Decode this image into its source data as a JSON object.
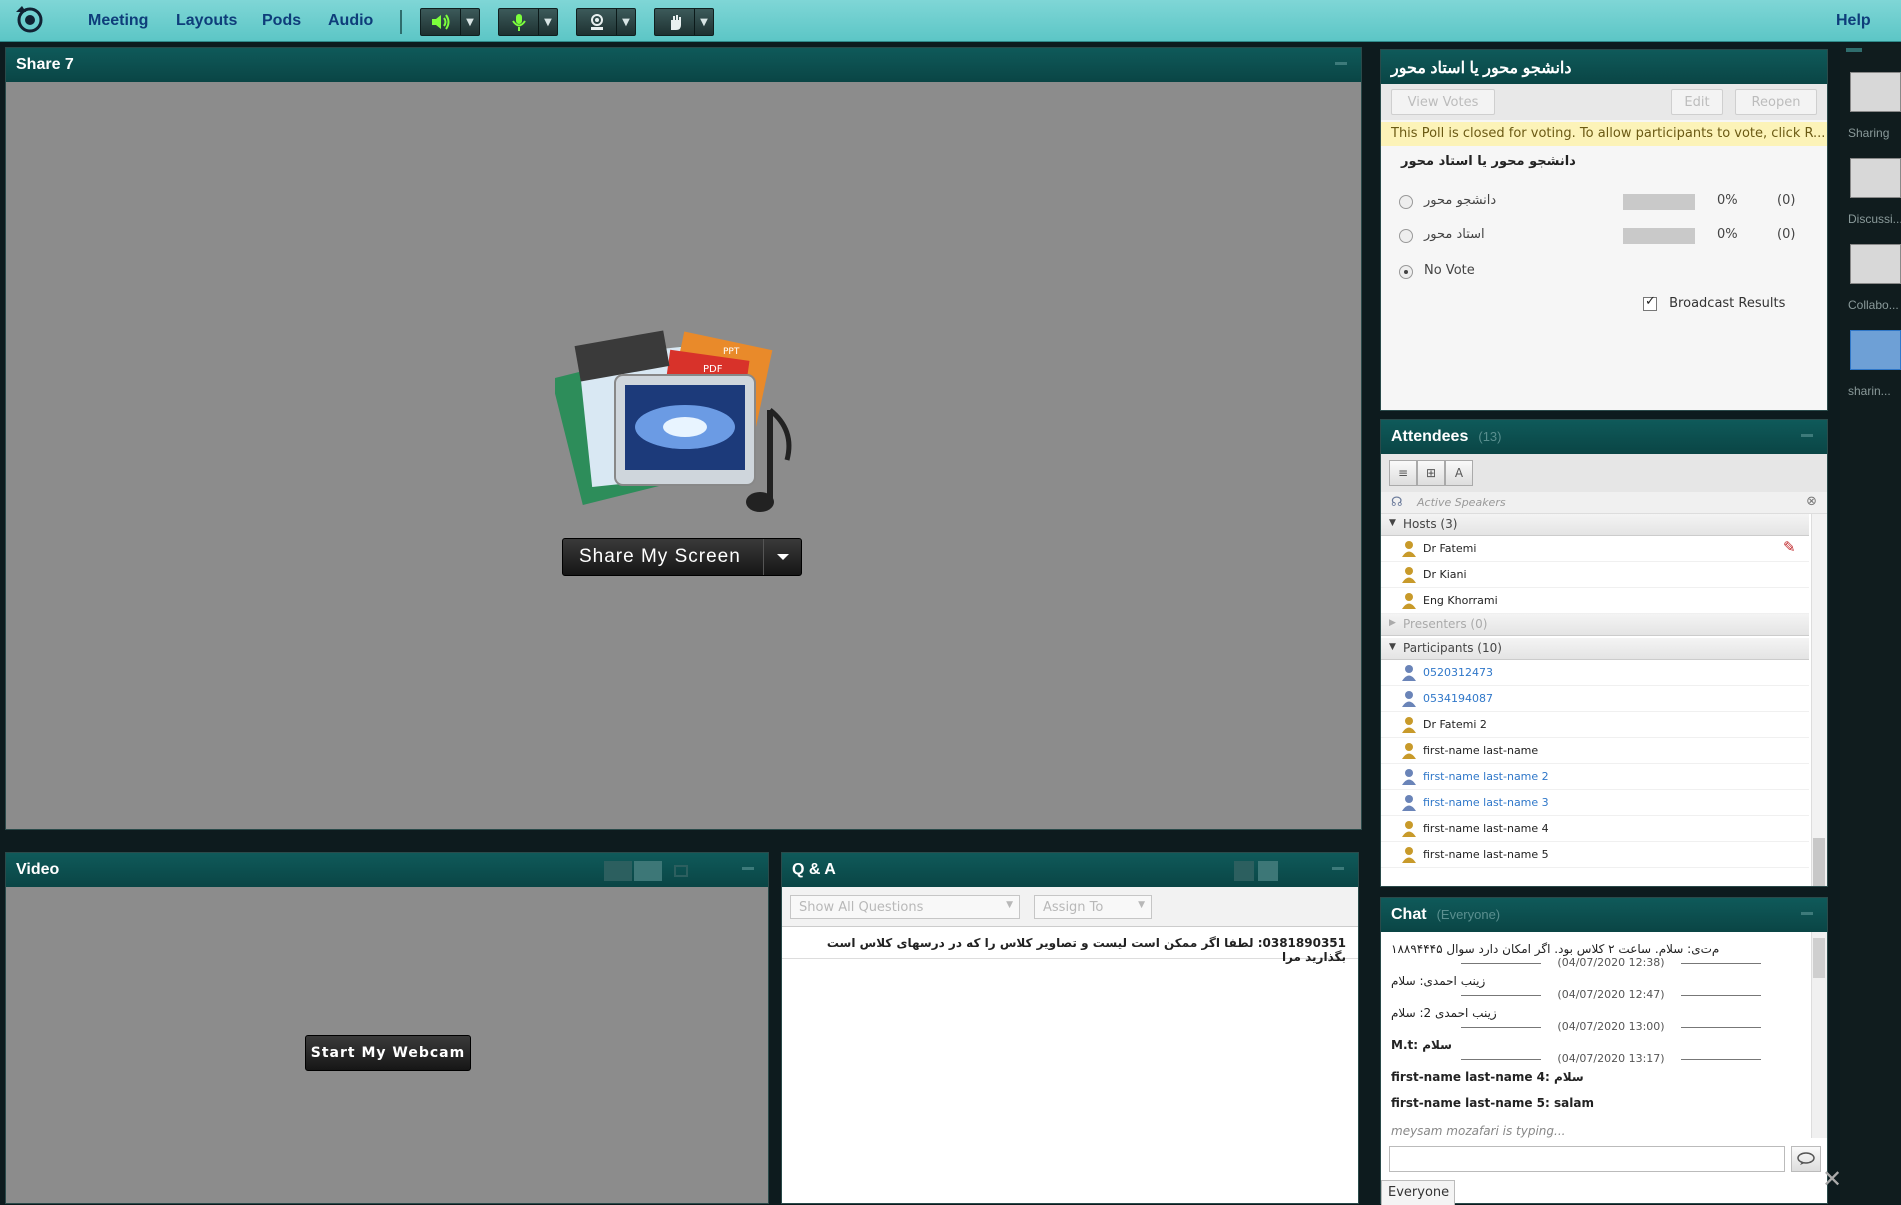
{
  "menubar": {
    "items": [
      "Meeting",
      "Layouts",
      "Pods",
      "Audio"
    ],
    "help": "Help"
  },
  "share_pod": {
    "title": "Share 7",
    "button_label": "Share My Screen"
  },
  "video_pod": {
    "title": "Video",
    "button_label": "Start My Webcam"
  },
  "qa_pod": {
    "title": "Q & A",
    "filter_placeholder": "Show All Questions",
    "assign_placeholder": "Assign To",
    "question": "0381890351: لطفا اگر ممکن است لیست و تصاویر کلاس را که در درسهای کلاس است بگذارید مرا"
  },
  "poll_pod": {
    "title": "دانشجو محور یا استاد محور",
    "view_votes": "View Votes",
    "edit": "Edit",
    "reopen": "Reopen",
    "notice": "This Poll is closed for voting. To allow participants to vote, click R...",
    "question": "دانشجو محور یا استاد محور",
    "options": [
      {
        "label": "دانشجو محور",
        "percent": "0%",
        "count": "(0)",
        "value": 0
      },
      {
        "label": "استاد محور",
        "percent": "0%",
        "count": "(0)",
        "value": 0
      }
    ],
    "no_vote": "No Vote",
    "broadcast": "Broadcast Results"
  },
  "attendees_pod": {
    "title": "Attendees",
    "count": "(13)",
    "active_speakers": "Active Speakers",
    "hosts_label": "Hosts (3)",
    "hosts": [
      "Dr Fatemi",
      "Dr Kiani",
      "Eng Khorrami"
    ],
    "presenters_label": "Presenters (0)",
    "participants_label": "Participants (10)",
    "participants": [
      {
        "name": "0520312473",
        "blue": true
      },
      {
        "name": "0534194087",
        "blue": true
      },
      {
        "name": "Dr Fatemi 2",
        "blue": false
      },
      {
        "name": "first-name last-name",
        "blue": false
      },
      {
        "name": "first-name last-name 2",
        "blue": true
      },
      {
        "name": "first-name last-name 3",
        "blue": true
      },
      {
        "name": "first-name last-name 4",
        "blue": false
      },
      {
        "name": "first-name last-name 5",
        "blue": false
      }
    ]
  },
  "chat_pod": {
    "title": "Chat",
    "scope": "(Everyone)",
    "messages": [
      {
        "text": "م‌ت‌ی: سلام. ساعت ۲ کلاس بود. اگر امکان دارد سوال ۱۸۸۹۴۴۴۵"
      },
      {
        "ts": "(04/07/2020 12:38)"
      },
      {
        "text": "زینب احمدی: سلام"
      },
      {
        "ts": "(04/07/2020 12:47)"
      },
      {
        "text": "زینب احمدی 2: سلام"
      },
      {
        "ts": "(04/07/2020 13:00)"
      },
      {
        "text": "M.t: سلام"
      },
      {
        "ts": "(04/07/2020 13:17)"
      },
      {
        "text": "first-name last-name 4: سلام"
      },
      {
        "text": "first-name last-name 5:  salam"
      }
    ],
    "typing": "meysam mozafari is typing...",
    "tab": "Everyone"
  },
  "rail": {
    "layouts": [
      "Sharing",
      "Discussi...",
      "Collabo...",
      "sharin..."
    ]
  },
  "colors": {
    "menubar": "#5cc6c6",
    "pod_header": "#0a4545",
    "pod_bg": "#8c8c8c",
    "link_blue": "#2f77c9"
  }
}
